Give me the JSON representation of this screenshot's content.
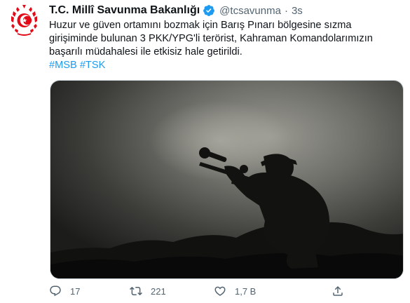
{
  "author": {
    "name": "T.C. Millî Savunma Bakanlığı",
    "handle": "@tcsavunma",
    "separator": "·",
    "time": "3s"
  },
  "tweet": {
    "lines": [
      "Huzur ve güven ortamını bozmak için Barış Pınarı bölgesine sızma",
      "girişiminde bulunan 3 PKK/YPG'li terörist, Kahraman Komandolarımızın",
      "başarılı müdahalesi ile etkisiz hale getirildi."
    ],
    "hashtags": [
      "#MSB",
      "#TSK"
    ]
  },
  "actions": {
    "reply": {
      "icon": "reply-icon",
      "count": "17"
    },
    "retweet": {
      "icon": "retweet-icon",
      "count": "221"
    },
    "like": {
      "icon": "like-icon",
      "count": "1,7 B"
    },
    "share": {
      "icon": "share-icon"
    }
  },
  "colors": {
    "accent": "#1d9bf0",
    "secondary_text": "#536471",
    "emblem_red": "#e30a17"
  }
}
